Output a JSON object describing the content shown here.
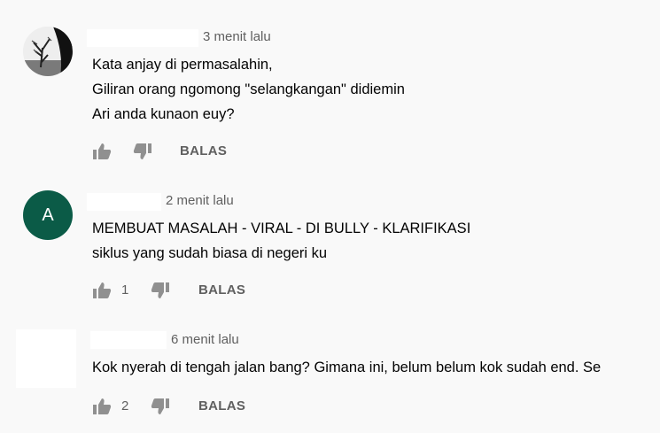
{
  "comments": [
    {
      "time": "3 menit lalu",
      "lines": [
        "Kata anjay di permasalahin,",
        "Giliran orang ngomong \"selangkangan\" didiemin",
        "Ari anda kunaon euy?"
      ],
      "like_count": "",
      "reply_label": "BALAS"
    },
    {
      "avatar_letter": "A",
      "time": "2 menit lalu",
      "lines": [
        "MEMBUAT MASALAH - VIRAL - DI BULLY - KLARIFIKASI",
        "siklus yang sudah biasa di negeri ku"
      ],
      "like_count": "1",
      "reply_label": "BALAS"
    },
    {
      "time": "6 menit lalu",
      "lines": [
        "Kok nyerah di tengah jalan bang? Gimana ini, belum belum kok sudah end. Se"
      ],
      "like_count": "2",
      "reply_label": "BALAS"
    }
  ],
  "colors": {
    "background": "#f9f9f9",
    "avatar_green": "#0b5b47",
    "meta_text": "#606060"
  }
}
